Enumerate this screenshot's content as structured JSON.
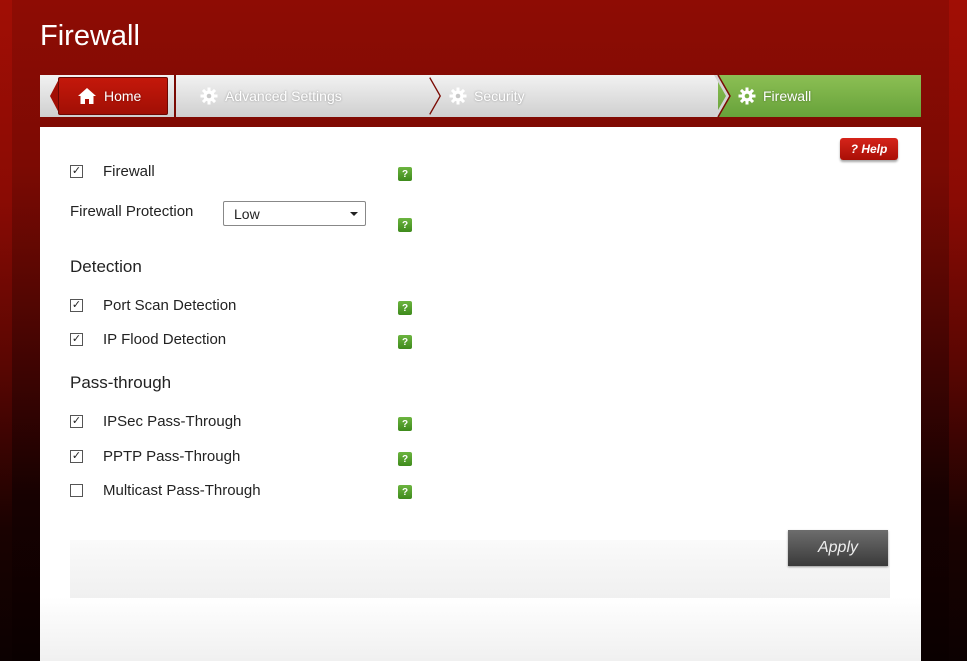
{
  "page": {
    "title": "Firewall"
  },
  "breadcrumb": {
    "home": "Home",
    "advanced": "Advanced Settings",
    "security": "Security",
    "current": "Firewall"
  },
  "help": {
    "label": "? Help"
  },
  "settings": {
    "firewall": {
      "label": "Firewall",
      "checked": true
    },
    "protection": {
      "label": "Firewall Protection",
      "value": "Low"
    }
  },
  "detection": {
    "title": "Detection",
    "port_scan": {
      "label": "Port Scan Detection",
      "checked": true
    },
    "ip_flood": {
      "label": "IP Flood Detection",
      "checked": true
    }
  },
  "passthrough": {
    "title": "Pass-through",
    "ipsec": {
      "label": "IPSec Pass-Through",
      "checked": true
    },
    "pptp": {
      "label": "PPTP Pass-Through",
      "checked": true
    },
    "multicast": {
      "label": "Multicast Pass-Through",
      "checked": false
    }
  },
  "actions": {
    "apply": "Apply"
  },
  "help_icon": "?",
  "check_mark": "✓",
  "colors": {
    "brand_red": "#a10e05",
    "active_crumb": "#7ab347",
    "help_icon": "#4f9b2a"
  }
}
